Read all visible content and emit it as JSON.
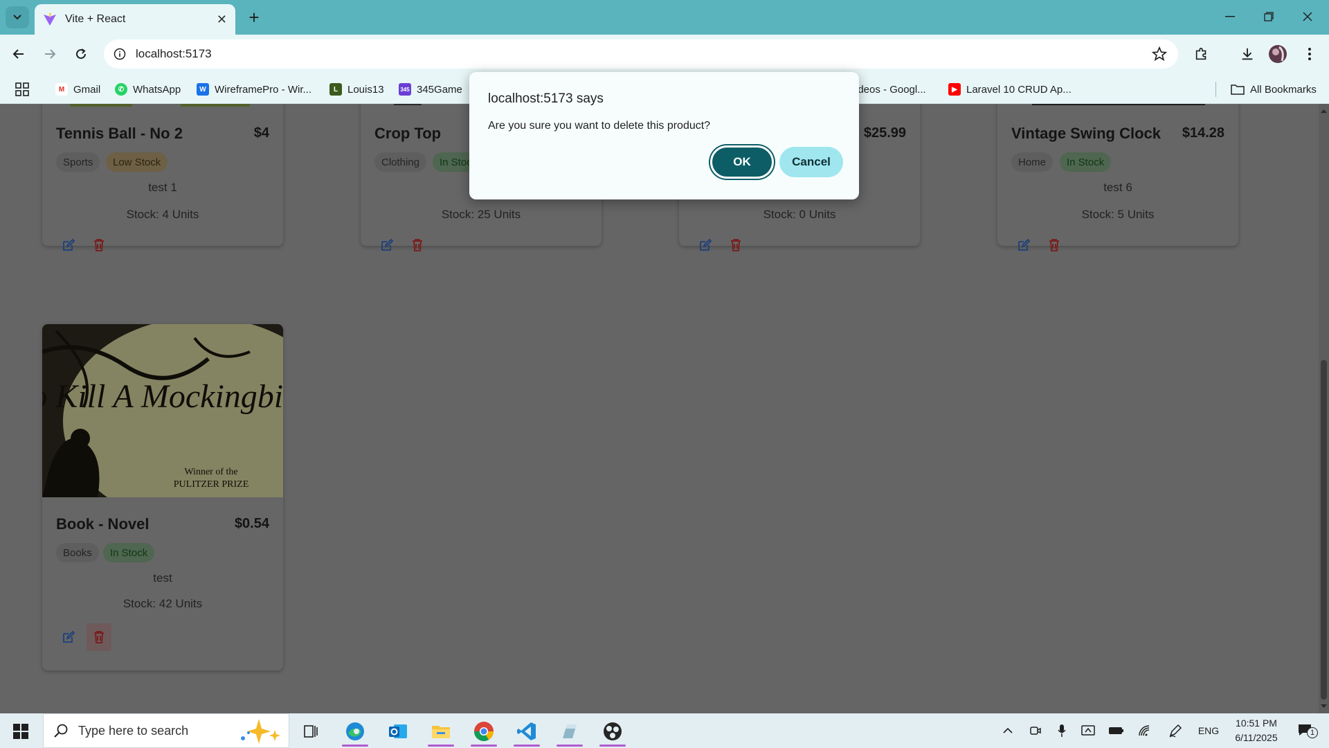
{
  "browser": {
    "tab_title": "Vite + React",
    "url": "localhost:5173",
    "bookmarks": [
      {
        "label": "Gmail"
      },
      {
        "label": "WhatsApp"
      },
      {
        "label": "WireframePro - Wir..."
      },
      {
        "label": "Louis13"
      },
      {
        "label": "345Game"
      },
      {
        "label": "ideos - Googl..."
      },
      {
        "label": "Laravel 10 CRUD Ap..."
      }
    ],
    "all_bookmarks": "All Bookmarks"
  },
  "products": [
    {
      "name": "Tennis Ball - No 2",
      "price": "$4",
      "category": "Sports",
      "status": "Low Stock",
      "desc": "test 1",
      "stock": "Stock: 4 Units"
    },
    {
      "name": "Crop Top",
      "price": "",
      "category": "Clothing",
      "status": "In Stock",
      "desc": "",
      "stock": "Stock: 25 Units"
    },
    {
      "name": "",
      "price": "$25.99",
      "category": "",
      "status": "",
      "desc": "",
      "stock": "Stock: 0 Units"
    },
    {
      "name": "Vintage Swing Clock",
      "price": "$14.28",
      "category": "Home",
      "status": "In Stock",
      "desc": "test 6",
      "stock": "Stock: 5 Units"
    },
    {
      "name": "Book - Novel",
      "price": "$0.54",
      "category": "Books",
      "status": "In Stock",
      "desc": "test",
      "stock": "Stock: 42 Units"
    }
  ],
  "book_cover": {
    "title": "To Kill A Mockingbird",
    "caption_1": "Winner of the",
    "caption_2": "PULITZER PRIZE"
  },
  "dialog": {
    "title": "localhost:5173 says",
    "message": "Are you sure you want to delete this product?",
    "ok": "OK",
    "cancel": "Cancel"
  },
  "taskbar": {
    "search_placeholder": "Type here to search",
    "lang": "ENG",
    "time": "10:51 PM",
    "date": "6/11/2025",
    "notifications": "1"
  },
  "colors": {
    "dialog_ok": "#0c5d66",
    "dialog_cancel": "#9fe6ef",
    "chrome": "#5ab4be"
  }
}
